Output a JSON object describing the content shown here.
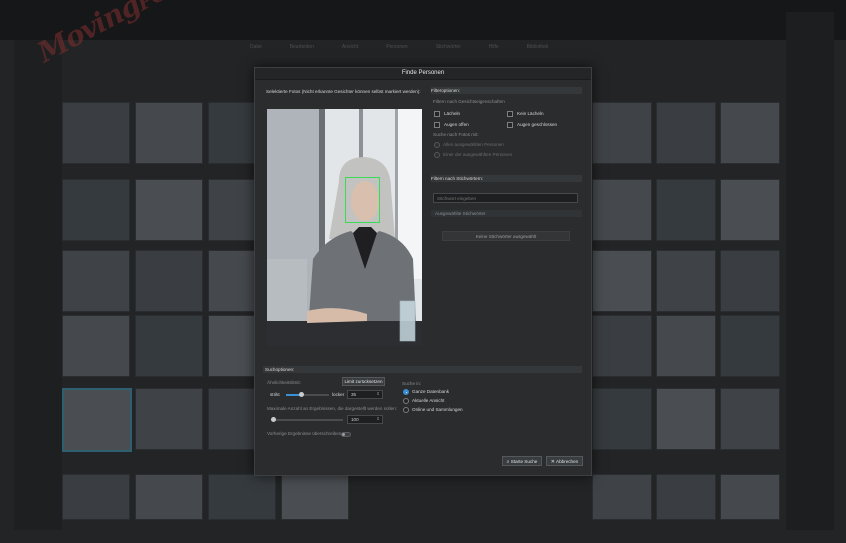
{
  "dialog": {
    "title": "Finde Personen",
    "selected_photos_label": "Selektierte Fotos (Nicht erkannte Gesichter können selbst markiert werden):",
    "filter": {
      "header": "Filteroptionen:",
      "face_props_label": "Filtern nach Gesichtseigenschaften",
      "smiling": "Lächeln",
      "not_smiling": "Kein Lächeln",
      "eyes_open": "Augen offen",
      "eyes_closed": "Augen geschlossen",
      "search_photos_with": "Suche nach Fotos mit:",
      "all_selected_persons": "Allen ausgewählten Personen",
      "one_selected_person": "Einer der ausgewählten Personen"
    },
    "keywords": {
      "header": "Filtern nach Stichwörtern:",
      "input_placeholder": "Stichwort eingeben",
      "selected_label": "Ausgewählte Stichwörter",
      "none_selected_button": "Keine Stichwörter ausgewählt"
    },
    "search": {
      "header": "Suchoptionen:",
      "similarity_label": "Ähnlichkeitslimit:",
      "reset_button": "Limit zurücksetzen",
      "strict": "strikt",
      "loose": "locker",
      "similarity_value": "35",
      "similarity_fraction": 0.35,
      "max_results_label": "Maximale Anzahl an Ergebnissen, die dargestellt werden sollen:",
      "max_results_value": "100",
      "max_results_fraction": 0.02,
      "overwrite_label": "Vorherige Ergebnisse überschreiben",
      "search_in_label": "Suche in:",
      "whole_db": "Ganze Datenbank",
      "current_view": "Aktuelle Ansicht",
      "online_collections": "Online und Sammlungen"
    },
    "buttons": {
      "start": "Starte Suche",
      "cancel": "Abbrechen"
    }
  },
  "background": {
    "watermark": "MovingPC",
    "nav": [
      "Datei",
      "Bearbeiten",
      "Ansicht",
      "Personen",
      "Stichwörter",
      "Hilfe",
      "Bibliothek"
    ]
  }
}
